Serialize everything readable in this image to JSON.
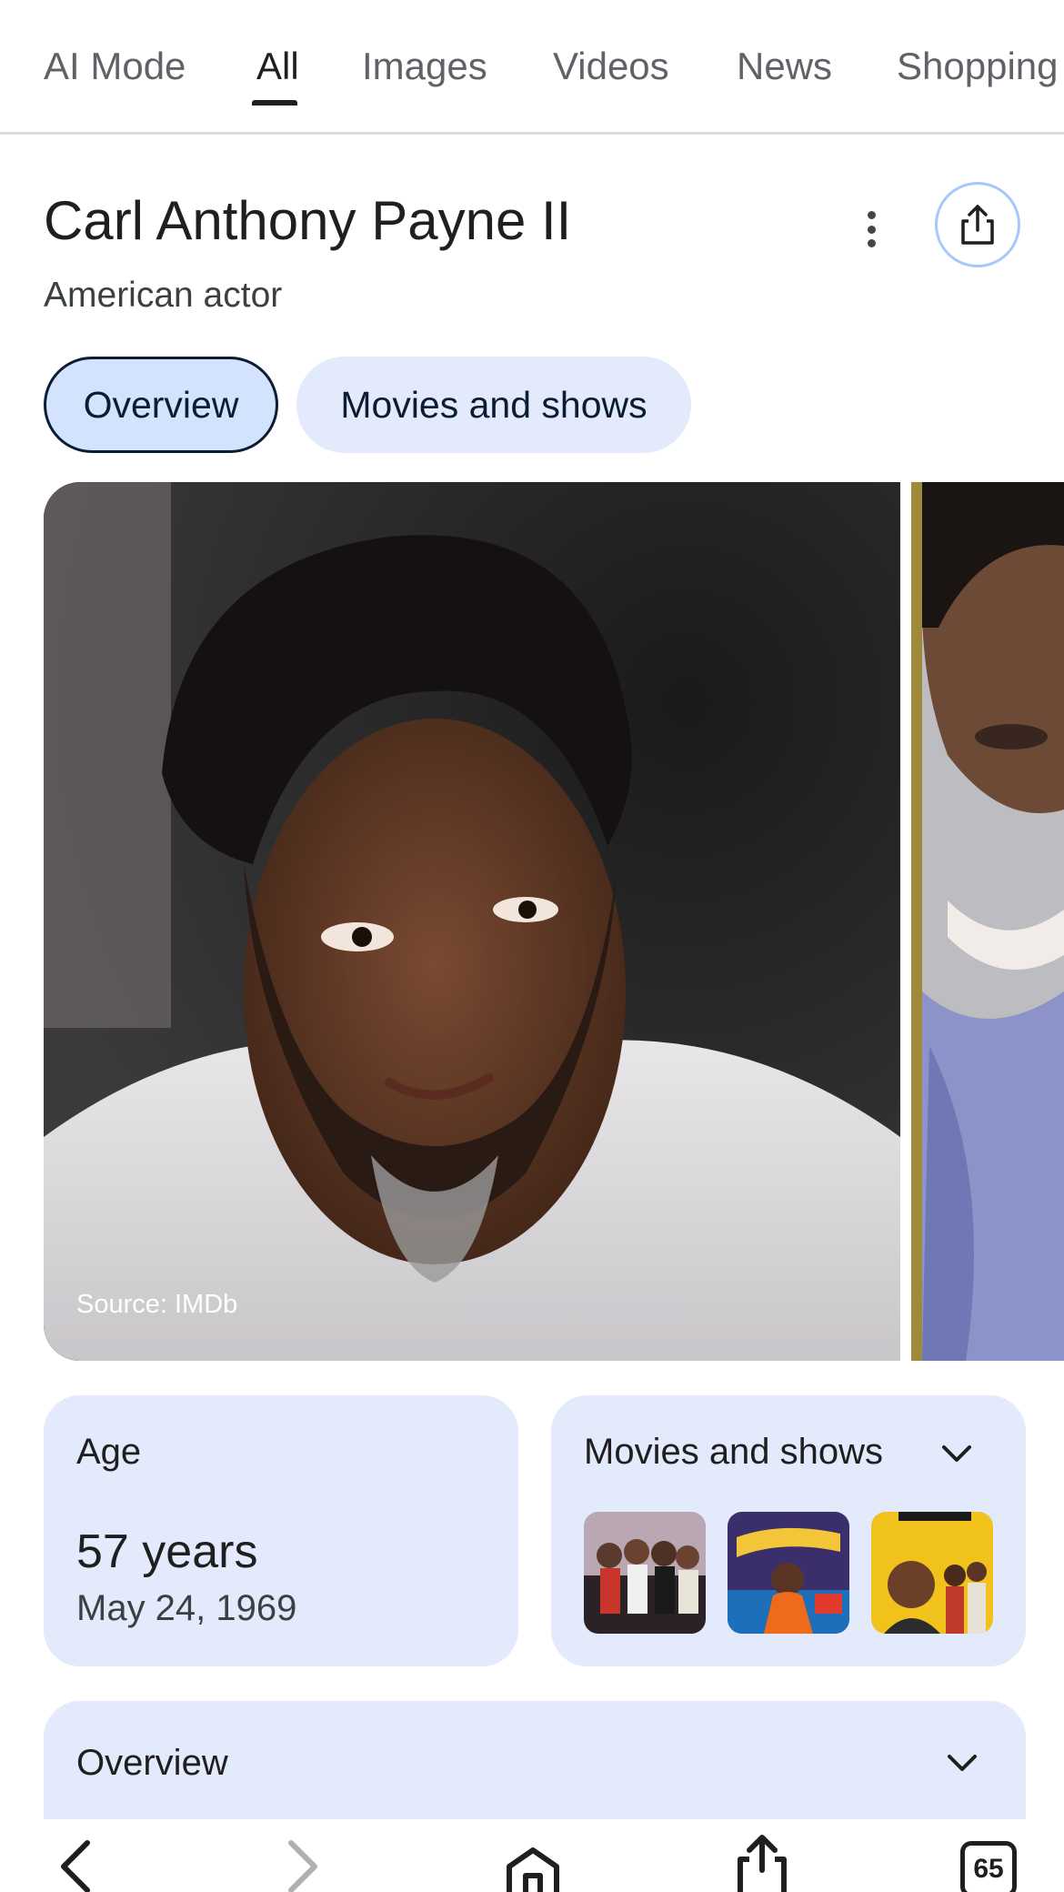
{
  "tabs": [
    {
      "label": "AI Mode",
      "active": false
    },
    {
      "label": "All",
      "active": true
    },
    {
      "label": "Images",
      "active": false
    },
    {
      "label": "Videos",
      "active": false
    },
    {
      "label": "News",
      "active": false
    },
    {
      "label": "Shopping",
      "active": false
    }
  ],
  "header": {
    "title": "Carl Anthony Payne II",
    "subtitle": "American actor"
  },
  "chips": [
    {
      "label": "Overview",
      "selected": true
    },
    {
      "label": "Movies and shows",
      "selected": false
    }
  ],
  "photos": {
    "source_label": "Source: IMDb"
  },
  "age_card": {
    "label": "Age",
    "value": "57 years",
    "date": "May 24, 1969"
  },
  "movies_card": {
    "label": "Movies and shows",
    "thumbnail_count": 3
  },
  "overview_card": {
    "label": "Overview"
  },
  "bottom_nav": {
    "tab_count": "65"
  },
  "colors": {
    "chip_selected": "#d3e3fd",
    "card_bg": "#e2eafc",
    "text_primary": "#1f1f1f",
    "text_secondary": "#5f6368"
  }
}
